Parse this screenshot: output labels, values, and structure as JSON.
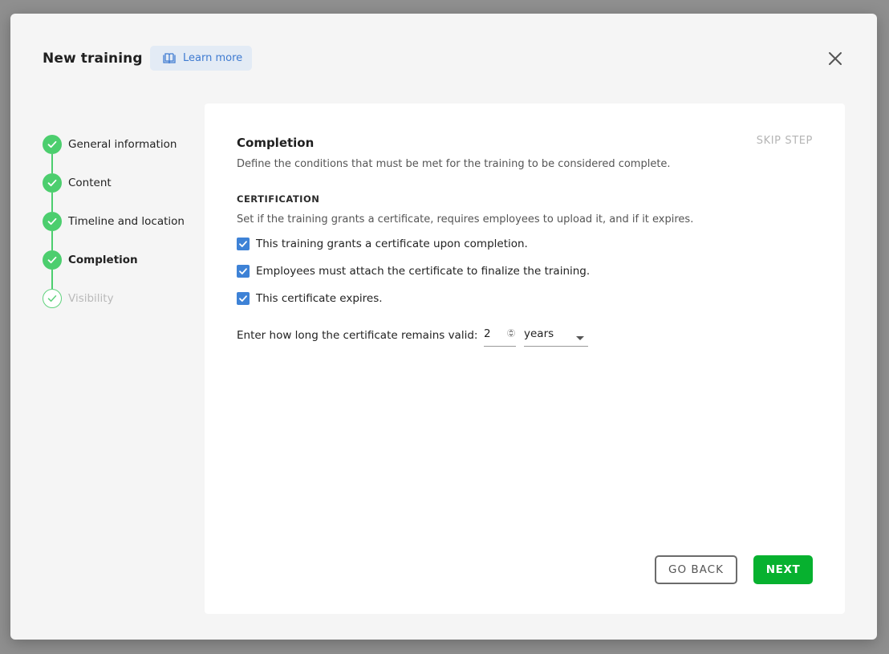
{
  "modal": {
    "title": "New training",
    "learn_more": "Learn more",
    "icons": {
      "learn_more": "book-open-icon",
      "close": "close-icon"
    }
  },
  "stepper": {
    "steps": [
      {
        "label": "General information",
        "state": "completed"
      },
      {
        "label": "Content",
        "state": "completed"
      },
      {
        "label": "Timeline and location",
        "state": "completed"
      },
      {
        "label": "Completion",
        "state": "current"
      },
      {
        "label": "Visibility",
        "state": "upcoming"
      }
    ]
  },
  "panel": {
    "title": "Completion",
    "skip_step": "SKIP STEP",
    "description": "Define the conditions that must be met for the training to be considered complete.",
    "certification": {
      "heading": "CERTIFICATION",
      "description": "Set if the training grants a certificate, requires employees to upload it, and if it expires.",
      "options": [
        {
          "label": "This training grants a certificate upon completion.",
          "checked": true
        },
        {
          "label": "Employees must attach the certificate to finalize the training.",
          "checked": true
        },
        {
          "label": "This certificate expires.",
          "checked": true
        }
      ],
      "validity_label": "Enter how long the certificate remains valid:",
      "validity_value": "2",
      "validity_unit": "years"
    },
    "buttons": {
      "back": "GO BACK",
      "next": "NEXT"
    }
  },
  "colors": {
    "accent_green": "#4cce6e",
    "next_button": "#07b12f",
    "checkbox_blue": "#3e82d6",
    "link_blue": "#3f7bd1"
  }
}
